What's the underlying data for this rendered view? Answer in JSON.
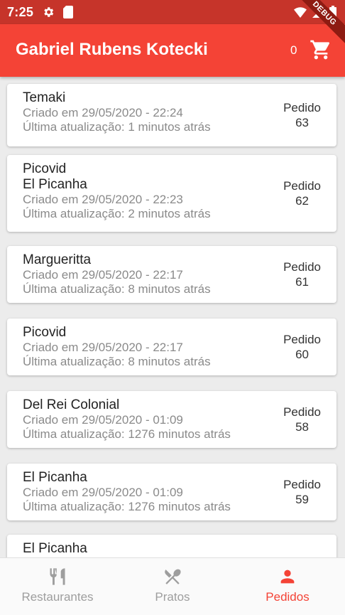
{
  "status_bar": {
    "time": "7:25",
    "debug_label": "DEBUG"
  },
  "app_bar": {
    "title": "Gabriel Rubens Kotecki",
    "cart_count": "0"
  },
  "orders": [
    {
      "names": [
        "Temaki"
      ],
      "created": "Criado em 29/05/2020 - 22:24",
      "updated": "Última atualização: 1 minutos atrás",
      "order_label": "Pedido",
      "order_number": "63"
    },
    {
      "names": [
        "Picovid",
        "El Picanha"
      ],
      "created": "Criado em 29/05/2020 - 22:23",
      "updated": "Última atualização: 2 minutos atrás",
      "order_label": "Pedido",
      "order_number": "62"
    },
    {
      "names": [
        "Margueritta"
      ],
      "created": "Criado em 29/05/2020 - 22:17",
      "updated": "Última atualização: 8 minutos atrás",
      "order_label": "Pedido",
      "order_number": "61"
    },
    {
      "names": [
        "Picovid"
      ],
      "created": "Criado em 29/05/2020 - 22:17",
      "updated": "Última atualização: 8 minutos atrás",
      "order_label": "Pedido",
      "order_number": "60"
    },
    {
      "names": [
        "Del Rei Colonial"
      ],
      "created": "Criado em 29/05/2020 - 01:09",
      "updated": "Última atualização: 1276 minutos atrás",
      "order_label": "Pedido",
      "order_number": "58"
    },
    {
      "names": [
        "El Picanha"
      ],
      "created": "Criado em 29/05/2020 - 01:09",
      "updated": "Última atualização: 1276 minutos atrás",
      "order_label": "Pedido",
      "order_number": "59"
    },
    {
      "names": [
        "El Picanha"
      ]
    }
  ],
  "bottom_nav": {
    "items": [
      {
        "label": "Restaurantes",
        "icon": "restaurant-icon"
      },
      {
        "label": "Pratos",
        "icon": "dishes-icon"
      },
      {
        "label": "Pedidos",
        "icon": "person-icon"
      }
    ],
    "active": "Pedidos"
  },
  "colors": {
    "primary": "#f44336",
    "status_bar": "#c6342a",
    "active_tab": "#f44336",
    "inactive_tab": "#9e9e9e"
  }
}
